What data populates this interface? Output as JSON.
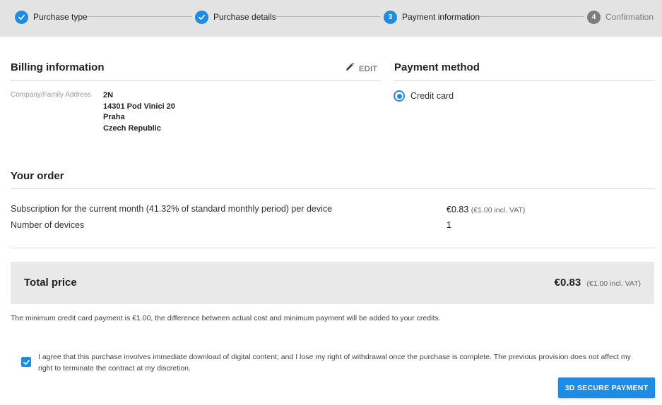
{
  "stepper": {
    "steps": [
      {
        "number": "",
        "label": "Purchase type",
        "state": "done"
      },
      {
        "number": "",
        "label": "Purchase details",
        "state": "done"
      },
      {
        "number": "3",
        "label": "Payment information",
        "state": "active"
      },
      {
        "number": "4",
        "label": "Confirmation",
        "state": "todo"
      }
    ]
  },
  "billing": {
    "title": "Billing information",
    "edit_label": "EDIT",
    "address_label": "Company/Family Address",
    "address_lines": [
      "2N",
      "14301 Pod Vinici 20",
      "Praha",
      "Czech Republic"
    ]
  },
  "payment_method": {
    "title": "Payment method",
    "option_label": "Credit card",
    "selected": true
  },
  "order": {
    "title": "Your order",
    "rows": [
      {
        "label": "Subscription for the current month (41.32% of standard monthly period) per device",
        "value": "€0.83",
        "value_note": "(€1.00 incl. VAT)"
      },
      {
        "label": "Number of devices",
        "value": "1",
        "value_note": ""
      }
    ]
  },
  "total": {
    "label": "Total price",
    "value": "€0.83",
    "value_note": "(€1.00 incl. VAT)"
  },
  "note": "The minimum credit card payment is €1.00, the difference between actual cost and minimum payment will be added to your credits.",
  "agreement": {
    "checked": true,
    "text": "I agree that this purchase involves immediate download of digital content; and I lose my right of withdrawal once the purchase is complete. The previous provision does not affect my right to terminate the contract at my discretion."
  },
  "pay_button_label": "3D SECURE PAYMENT",
  "colors": {
    "accent": "#1d8ce6",
    "stepper_bg": "#e3e3e3",
    "total_bg": "#e9e9e9"
  }
}
